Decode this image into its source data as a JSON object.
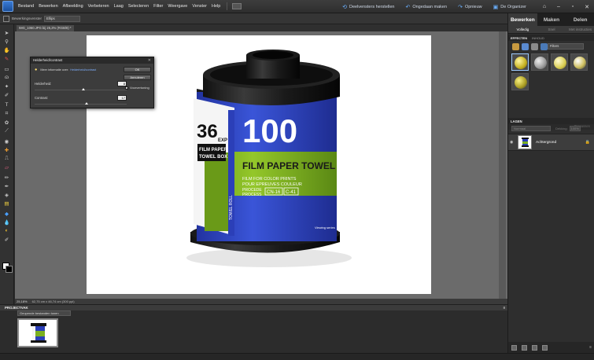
{
  "menubar": {
    "items": [
      "Bestand",
      "Bewerken",
      "Afbeelding",
      "Verbeteren",
      "Laag",
      "Selecteren",
      "Filter",
      "Weergave",
      "Venster",
      "Help"
    ],
    "right_links": [
      {
        "label": "Deelvensters herstellen",
        "icon": "restore-icon"
      },
      {
        "label": "Ongedaan maken",
        "icon": "undo-icon"
      },
      {
        "label": "Opnieuw",
        "icon": "redo-icon"
      },
      {
        "label": "De Organizer",
        "icon": "organizer-icon"
      }
    ]
  },
  "options_bar": {
    "label": "Bewerkingsvenster",
    "value": "Ellips"
  },
  "document": {
    "tab_title": "IMG_1060.JPG bij 25,2% (RGB/8) *",
    "zoom": "25,18%",
    "info": "62,75 cm x 46,74 cm (300 ppi)",
    "label_left": "36",
    "label_left_suffix": "EXP",
    "label_left_line1": "FILM PAPER",
    "label_left_line2": "TOWEL BOX",
    "label_number": "100",
    "label_title": "FILM PAPER TOWEL",
    "label_line1": "FILM FOR COLOR PRINTS",
    "label_line2": "POUR EPREUVES COULEUR",
    "label_proc1": "PROCEDE",
    "label_proc2": "PROCESS",
    "label_proc_box1": "CN-16",
    "label_proc_box2": "C-41",
    "label_vertical": "TOWEL ROLL",
    "label_brand": "Viewing series"
  },
  "dialog": {
    "title": "Helderheid/contrast",
    "info_text": "Meer informatie over:",
    "info_link": "Helderheid/contrast",
    "ok": "OK",
    "cancel": "Annuleren",
    "help": "Help",
    "preview_label": "Voorvertoning",
    "brightness_label": "Helderheid:",
    "brightness_value": "8",
    "brightness_level": 0.53,
    "contrast_label": "Contrast:",
    "contrast_value": "17",
    "contrast_level": 0.56
  },
  "project_bin": {
    "title": "PROJECTVAK",
    "select": "Geopende bestanden tonen"
  },
  "right_panel": {
    "tabs": [
      "Bewerken",
      "Maken",
      "Delen"
    ],
    "subtabs": [
      "Volledig",
      "Snel",
      "Met instructies"
    ],
    "effects_tab": "EFFECTEN",
    "effects_tab2": "INHOUD",
    "effects_select": "Filters",
    "effects_footer": "Toepassen",
    "layers_title": "LAGEN",
    "layers_mode": "Normaal",
    "layers_opacity_label": "Dekking:",
    "layers_opacity": "100%",
    "layer_name": "Achtergrond"
  }
}
